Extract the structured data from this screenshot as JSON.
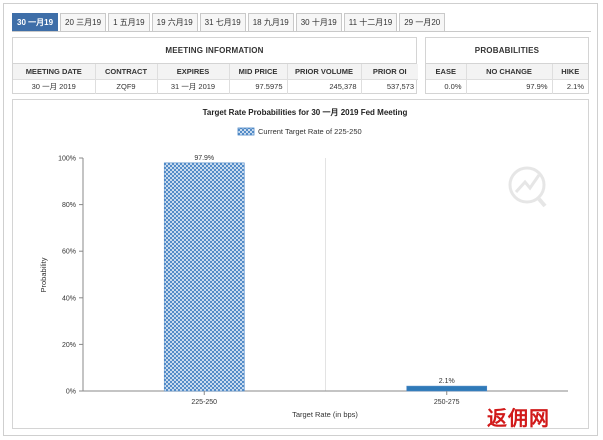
{
  "tabs": [
    {
      "label": "30 一月19",
      "active": true
    },
    {
      "label": "20 三月19",
      "active": false
    },
    {
      "label": "1 五月19",
      "active": false
    },
    {
      "label": "19 六月19",
      "active": false
    },
    {
      "label": "31 七月19",
      "active": false
    },
    {
      "label": "18 九月19",
      "active": false
    },
    {
      "label": "30 十月19",
      "active": false
    },
    {
      "label": "11 十二月19",
      "active": false
    },
    {
      "label": "29 一月20",
      "active": false
    }
  ],
  "meeting": {
    "title": "MEETING INFORMATION",
    "headers": [
      "MEETING DATE",
      "CONTRACT",
      "EXPIRES",
      "MID PRICE",
      "PRIOR VOLUME",
      "PRIOR OI"
    ],
    "row": [
      "30 一月 2019",
      "ZQF9",
      "31 一月 2019",
      "97.5975",
      "245,378",
      "537,573"
    ]
  },
  "probabilities": {
    "title": "PROBABILITIES",
    "headers": [
      "EASE",
      "NO CHANGE",
      "HIKE"
    ],
    "row": [
      "0.0%",
      "97.9%",
      "2.1%"
    ]
  },
  "chart_data": {
    "type": "bar",
    "title": "Target Rate Probabilities for 30 一月 2019 Fed Meeting",
    "legend": "Current Target Rate of 225-250",
    "legend_position": "top-center",
    "categories": [
      "225-250",
      "250-275"
    ],
    "values": [
      97.9,
      2.1
    ],
    "data_labels": [
      "97.9%",
      "2.1%"
    ],
    "xlabel": "Target Rate (in bps)",
    "ylabel": "Probability",
    "ylim": [
      0,
      100
    ],
    "yticks": [
      "0%",
      "20%",
      "40%",
      "60%",
      "80%",
      "100%"
    ],
    "grid": "vertical",
    "colors": {
      "current": "#4a86c5",
      "other": "#2f7ab8"
    }
  },
  "watermark": "返佣网"
}
